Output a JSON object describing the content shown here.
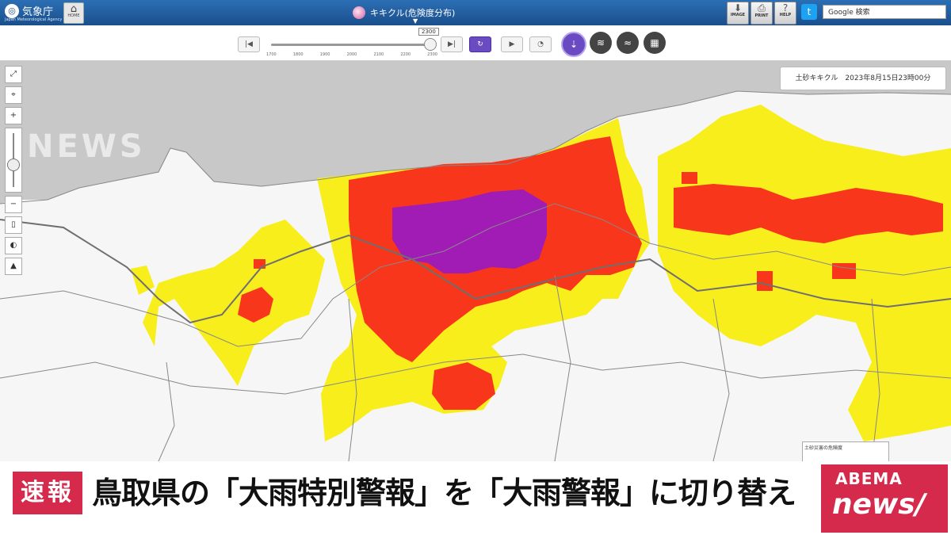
{
  "header": {
    "site_logo": "気象庁",
    "site_logo_sub": "Japan Meteorological Agency",
    "home_label": "HOME",
    "content_title": "キキクル(危険度分布)",
    "image_label": "IMAGE",
    "print_label": "PRINT",
    "help_label": "HELP",
    "search_placeholder": "Google 検索"
  },
  "controls": {
    "time_value": "2300",
    "ticks": [
      "1700",
      "1800",
      "1900",
      "2000",
      "2100",
      "2200",
      "2300"
    ]
  },
  "map": {
    "info_text": "土砂キキクル　2023年8月15日23時00分",
    "legend_title": "土砂災害の危険度",
    "watermark": "NEWS",
    "colors": {
      "sea": "#c8c8c8",
      "land": "#f6f6f6",
      "yellow": "#f7ee1b",
      "red": "#f8361c",
      "purple": "#a01cb4"
    }
  },
  "banner": {
    "breaking_label": "速報",
    "headline": "鳥取県の「大雨特別警報」を「大雨警報」に切り替え",
    "brand_top": "ABEMA",
    "brand_bottom": "news/"
  }
}
